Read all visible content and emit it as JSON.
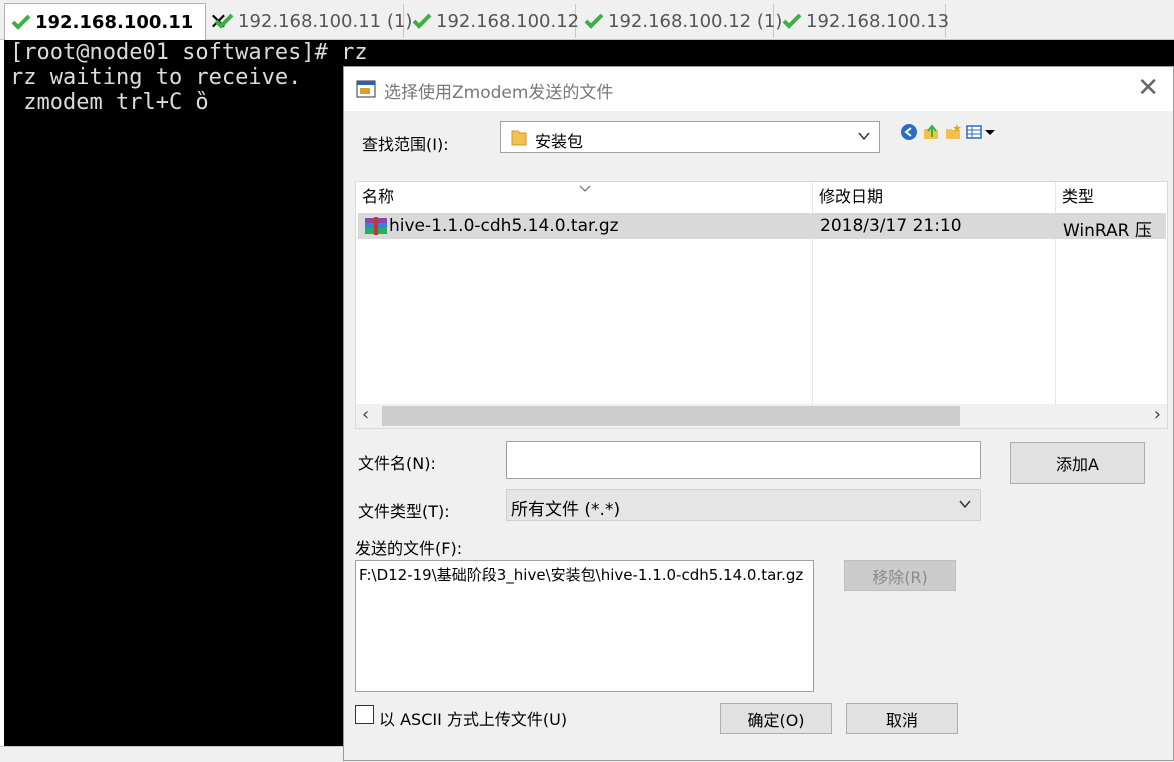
{
  "tabs": [
    {
      "label": "192.168.100.11",
      "active": true
    },
    {
      "label": "192.168.100.11 (1)",
      "active": false
    },
    {
      "label": "192.168.100.12",
      "active": false
    },
    {
      "label": "192.168.100.12 (1)",
      "active": false
    },
    {
      "label": "192.168.100.13",
      "active": false
    }
  ],
  "terminal": {
    "lines": [
      "[root@node01 softwares]# rz",
      "rz waiting to receive.",
      " zmodem trl+C ȍ"
    ]
  },
  "dialog": {
    "title": "选择使用Zmodem发送的文件",
    "look_in_label": "查找范围(I):",
    "look_in_value": "安装包",
    "columns": {
      "name": "名称",
      "modified": "修改日期",
      "type": "类型"
    },
    "files": [
      {
        "name": "hive-1.1.0-cdh5.14.0.tar.gz",
        "modified": "2018/3/17 21:10",
        "type": "WinRAR 压"
      }
    ],
    "filename_label": "文件名(N):",
    "filename_value": "",
    "add_button": "添加A",
    "filetype_label": "文件类型(T):",
    "filetype_value": "所有文件 (*.*)",
    "sent_files_label": "发送的文件(F):",
    "sent_files": [
      "F:\\D12-19\\基础阶段3_hive\\安装包\\hive-1.1.0-cdh5.14.0.tar.gz"
    ],
    "remove_button": "移除(R)",
    "ascii_checkbox_label": "以 ASCII 方式上传文件(U)",
    "ascii_checked": false,
    "ok_button": "确定(O)",
    "cancel_button": "取消"
  },
  "icons": {
    "tab_status": "green-check-icon",
    "tab_close": "close-icon",
    "dialog_close": "close-icon",
    "folder": "folder-icon",
    "back": "back-icon",
    "up": "up-folder-icon",
    "new_folder": "new-folder-icon",
    "view_menu": "view-menu-icon",
    "archive": "winrar-archive-icon"
  },
  "colors": {
    "terminal_bg": "#000000",
    "terminal_fg": "#dcdcdc",
    "check": "#3cb043",
    "selection": "#d9d9d9"
  }
}
